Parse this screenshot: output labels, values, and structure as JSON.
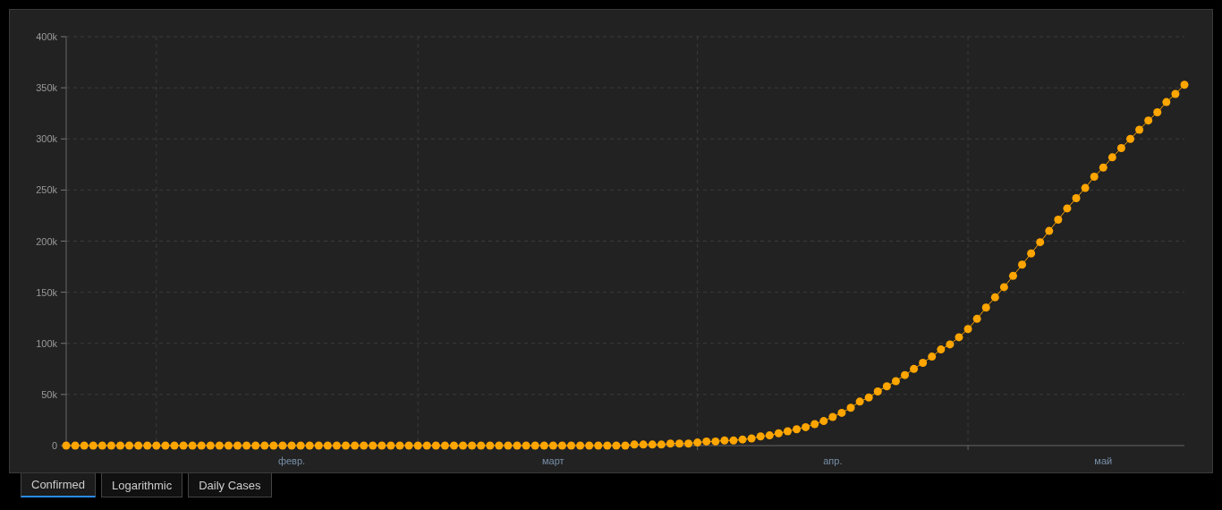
{
  "chart": {
    "chart_data": {
      "type": "line",
      "grid": true,
      "ylim": [
        0,
        400000
      ],
      "yticks": [
        {
          "value": 0,
          "label": "0"
        },
        {
          "value": 50000,
          "label": "50k"
        },
        {
          "value": 100000,
          "label": "100k"
        },
        {
          "value": 150000,
          "label": "150k"
        },
        {
          "value": 200000,
          "label": "200k"
        },
        {
          "value": 250000,
          "label": "250k"
        },
        {
          "value": 300000,
          "label": "300k"
        },
        {
          "value": 350000,
          "label": "350k"
        },
        {
          "value": 400000,
          "label": "400k"
        }
      ],
      "categories": [
        null,
        null,
        null,
        null,
        null,
        null,
        null,
        null,
        null,
        null,
        null,
        null,
        null,
        null,
        null,
        null,
        null,
        null,
        null,
        null,
        null,
        null,
        null,
        null,
        null,
        "февр.",
        null,
        null,
        null,
        null,
        null,
        null,
        null,
        null,
        null,
        null,
        null,
        null,
        null,
        null,
        null,
        null,
        null,
        null,
        null,
        null,
        null,
        null,
        null,
        null,
        null,
        null,
        null,
        null,
        "март",
        null,
        null,
        null,
        null,
        null,
        null,
        null,
        null,
        null,
        null,
        null,
        null,
        null,
        null,
        null,
        null,
        null,
        null,
        null,
        null,
        null,
        null,
        null,
        null,
        null,
        null,
        null,
        null,
        null,
        null,
        "апр.",
        null,
        null,
        null,
        null,
        null,
        null,
        null,
        null,
        null,
        null,
        null,
        null,
        null,
        null,
        null,
        null,
        null,
        null,
        null,
        null,
        null,
        null,
        null,
        null,
        null,
        null,
        null,
        null,
        null,
        "май",
        null,
        null,
        null,
        null,
        null,
        null,
        null,
        null,
        null
      ],
      "series": [
        {
          "color": "#ffa500",
          "marker": "circle",
          "values": [
            0,
            0,
            0,
            0,
            0,
            0,
            0,
            0,
            0,
            0,
            0,
            0,
            0,
            0,
            0,
            0,
            0,
            0,
            0,
            0,
            0,
            0,
            0,
            0,
            0,
            0,
            0,
            0,
            0,
            0,
            0,
            0,
            0,
            0,
            0,
            0,
            0,
            0,
            0,
            0,
            0,
            0,
            0,
            0,
            0,
            0,
            0,
            0,
            0,
            0,
            0,
            0,
            0,
            0,
            0,
            0,
            0,
            0,
            0,
            0,
            0,
            0,
            0,
            1000,
            1000,
            1000,
            1000,
            2000,
            2000,
            2000,
            3000,
            4000,
            4000,
            5000,
            5000,
            6000,
            7000,
            9000,
            10000,
            12000,
            14000,
            16000,
            18000,
            21000,
            24000,
            28000,
            32000,
            37000,
            43000,
            47000,
            53000,
            58000,
            63000,
            69000,
            75000,
            81000,
            87000,
            94000,
            99000,
            106000,
            114000,
            124000,
            135000,
            145000,
            155000,
            166000,
            177000,
            188000,
            199000,
            210000,
            221000,
            232000,
            242000,
            252000,
            263000,
            272000,
            282000,
            291000,
            300000,
            309000,
            318000,
            326000,
            336000,
            344000,
            353000
          ]
        }
      ]
    }
  },
  "tabs": [
    {
      "label": "Confirmed",
      "selected": true
    },
    {
      "label": "Logarithmic",
      "selected": false
    },
    {
      "label": "Daily Cases",
      "selected": false
    }
  ]
}
